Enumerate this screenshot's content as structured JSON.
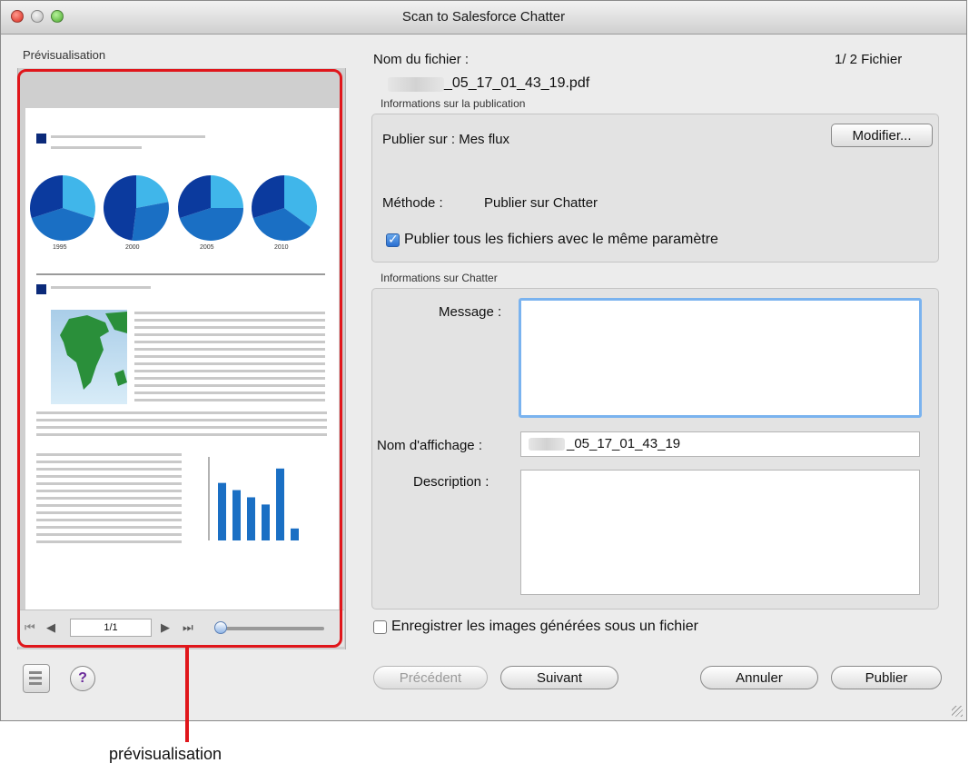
{
  "window": {
    "title": "Scan to Salesforce Chatter"
  },
  "preview": {
    "label": "Prévisualisation",
    "page_indicator": "1/1",
    "zoom_level": 0.05,
    "years": [
      "1995",
      "2000",
      "2005",
      "2010"
    ],
    "pie_values": [
      [
        0.3,
        0.4,
        0.3
      ],
      [
        0.22,
        0.3,
        0.48
      ],
      [
        0.25,
        0.45,
        0.3
      ],
      [
        0.35,
        0.35,
        0.3
      ]
    ],
    "bar_values": [
      0.72,
      0.63,
      0.54,
      0.45,
      0.9,
      0.15
    ],
    "colors": {
      "light": "#40b6ea",
      "mid": "#1a6fc4",
      "dark": "#0b3a9e"
    }
  },
  "file": {
    "name_label": "Nom du fichier :",
    "counter": "1/  2 Fichier",
    "filename_suffix": "_05_17_01_43_19.pdf"
  },
  "publication": {
    "group_label": "Informations sur la publication",
    "publish_on": "Publier sur : Mes flux",
    "modify_button": "Modifier...",
    "method_label": "Méthode :",
    "method_value": "Publier sur Chatter",
    "same_params": "Publier tous les fichiers avec le même paramètre",
    "same_params_checked": true
  },
  "chatter": {
    "group_label": "Informations sur Chatter",
    "message_label": "Message :",
    "message_value": "",
    "display_name_label": "Nom d'affichage :",
    "display_name_suffix": "_05_17_01_43_19",
    "description_label": "Description :",
    "description_value": ""
  },
  "save_images": {
    "label": "Enregistrer les images générées sous un fichier",
    "checked": false
  },
  "buttons": {
    "previous": "Précédent",
    "next": "Suivant",
    "cancel": "Annuler",
    "publish": "Publier"
  },
  "annotation": {
    "caption": "prévisualisation",
    "color": "#e0161b"
  }
}
